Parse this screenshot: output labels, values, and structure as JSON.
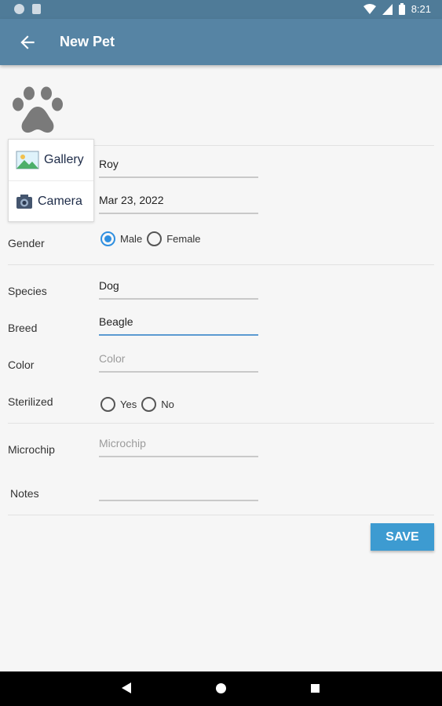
{
  "status": {
    "time": "8:21"
  },
  "app_bar": {
    "title": "New Pet"
  },
  "picker": {
    "gallery_label": "Gallery",
    "camera_label": "Camera"
  },
  "form": {
    "name": {
      "value": "Roy"
    },
    "birth_date": {
      "value": "Mar 23, 2022"
    },
    "gender": {
      "label": "Gender",
      "options": [
        "Male",
        "Female"
      ],
      "selected": "Male"
    },
    "species": {
      "label": "Species",
      "value": "Dog"
    },
    "breed": {
      "label": "Breed",
      "value": "Beagle"
    },
    "color": {
      "label": "Color",
      "value": "",
      "placeholder": "Color"
    },
    "sterilized": {
      "label": "Sterilized",
      "options": [
        "Yes",
        "No"
      ],
      "selected": ""
    },
    "microchip": {
      "label": "Microchip",
      "value": "",
      "placeholder": "Microchip"
    },
    "notes": {
      "label": "Notes",
      "value": ""
    }
  },
  "actions": {
    "save_label": "SAVE"
  },
  "colors": {
    "app_bar": "#5684a4",
    "status_bar": "#4f7b98",
    "accent": "#3d9bd1",
    "radio_checked": "#2f8fe0"
  }
}
